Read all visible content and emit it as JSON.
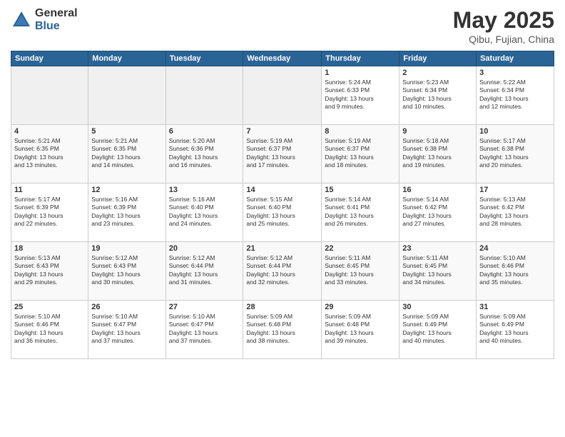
{
  "header": {
    "logo_general": "General",
    "logo_blue": "Blue",
    "month": "May 2025",
    "location": "Qibu, Fujian, China"
  },
  "days_of_week": [
    "Sunday",
    "Monday",
    "Tuesday",
    "Wednesday",
    "Thursday",
    "Friday",
    "Saturday"
  ],
  "weeks": [
    [
      {
        "day": "",
        "info": ""
      },
      {
        "day": "",
        "info": ""
      },
      {
        "day": "",
        "info": ""
      },
      {
        "day": "",
        "info": ""
      },
      {
        "day": "1",
        "info": "Sunrise: 5:24 AM\nSunset: 6:33 PM\nDaylight: 13 hours\nand 9 minutes."
      },
      {
        "day": "2",
        "info": "Sunrise: 5:23 AM\nSunset: 6:34 PM\nDaylight: 13 hours\nand 10 minutes."
      },
      {
        "day": "3",
        "info": "Sunrise: 5:22 AM\nSunset: 6:34 PM\nDaylight: 13 hours\nand 12 minutes."
      }
    ],
    [
      {
        "day": "4",
        "info": "Sunrise: 5:21 AM\nSunset: 6:35 PM\nDaylight: 13 hours\nand 13 minutes."
      },
      {
        "day": "5",
        "info": "Sunrise: 5:21 AM\nSunset: 6:35 PM\nDaylight: 13 hours\nand 14 minutes."
      },
      {
        "day": "6",
        "info": "Sunrise: 5:20 AM\nSunset: 6:36 PM\nDaylight: 13 hours\nand 16 minutes."
      },
      {
        "day": "7",
        "info": "Sunrise: 5:19 AM\nSunset: 6:37 PM\nDaylight: 13 hours\nand 17 minutes."
      },
      {
        "day": "8",
        "info": "Sunrise: 5:19 AM\nSunset: 6:37 PM\nDaylight: 13 hours\nand 18 minutes."
      },
      {
        "day": "9",
        "info": "Sunrise: 5:18 AM\nSunset: 6:38 PM\nDaylight: 13 hours\nand 19 minutes."
      },
      {
        "day": "10",
        "info": "Sunrise: 5:17 AM\nSunset: 6:38 PM\nDaylight: 13 hours\nand 20 minutes."
      }
    ],
    [
      {
        "day": "11",
        "info": "Sunrise: 5:17 AM\nSunset: 6:39 PM\nDaylight: 13 hours\nand 22 minutes."
      },
      {
        "day": "12",
        "info": "Sunrise: 5:16 AM\nSunset: 6:39 PM\nDaylight: 13 hours\nand 23 minutes."
      },
      {
        "day": "13",
        "info": "Sunrise: 5:16 AM\nSunset: 6:40 PM\nDaylight: 13 hours\nand 24 minutes."
      },
      {
        "day": "14",
        "info": "Sunrise: 5:15 AM\nSunset: 6:40 PM\nDaylight: 13 hours\nand 25 minutes."
      },
      {
        "day": "15",
        "info": "Sunrise: 5:14 AM\nSunset: 6:41 PM\nDaylight: 13 hours\nand 26 minutes."
      },
      {
        "day": "16",
        "info": "Sunrise: 5:14 AM\nSunset: 6:42 PM\nDaylight: 13 hours\nand 27 minutes."
      },
      {
        "day": "17",
        "info": "Sunrise: 5:13 AM\nSunset: 6:42 PM\nDaylight: 13 hours\nand 28 minutes."
      }
    ],
    [
      {
        "day": "18",
        "info": "Sunrise: 5:13 AM\nSunset: 6:43 PM\nDaylight: 13 hours\nand 29 minutes."
      },
      {
        "day": "19",
        "info": "Sunrise: 5:12 AM\nSunset: 6:43 PM\nDaylight: 13 hours\nand 30 minutes."
      },
      {
        "day": "20",
        "info": "Sunrise: 5:12 AM\nSunset: 6:44 PM\nDaylight: 13 hours\nand 31 minutes."
      },
      {
        "day": "21",
        "info": "Sunrise: 5:12 AM\nSunset: 6:44 PM\nDaylight: 13 hours\nand 32 minutes."
      },
      {
        "day": "22",
        "info": "Sunrise: 5:11 AM\nSunset: 6:45 PM\nDaylight: 13 hours\nand 33 minutes."
      },
      {
        "day": "23",
        "info": "Sunrise: 5:11 AM\nSunset: 6:45 PM\nDaylight: 13 hours\nand 34 minutes."
      },
      {
        "day": "24",
        "info": "Sunrise: 5:10 AM\nSunset: 6:46 PM\nDaylight: 13 hours\nand 35 minutes."
      }
    ],
    [
      {
        "day": "25",
        "info": "Sunrise: 5:10 AM\nSunset: 6:46 PM\nDaylight: 13 hours\nand 36 minutes."
      },
      {
        "day": "26",
        "info": "Sunrise: 5:10 AM\nSunset: 6:47 PM\nDaylight: 13 hours\nand 37 minutes."
      },
      {
        "day": "27",
        "info": "Sunrise: 5:10 AM\nSunset: 6:47 PM\nDaylight: 13 hours\nand 37 minutes."
      },
      {
        "day": "28",
        "info": "Sunrise: 5:09 AM\nSunset: 6:48 PM\nDaylight: 13 hours\nand 38 minutes."
      },
      {
        "day": "29",
        "info": "Sunrise: 5:09 AM\nSunset: 6:48 PM\nDaylight: 13 hours\nand 39 minutes."
      },
      {
        "day": "30",
        "info": "Sunrise: 5:09 AM\nSunset: 6:49 PM\nDaylight: 13 hours\nand 40 minutes."
      },
      {
        "day": "31",
        "info": "Sunrise: 5:09 AM\nSunset: 6:49 PM\nDaylight: 13 hours\nand 40 minutes."
      }
    ]
  ]
}
